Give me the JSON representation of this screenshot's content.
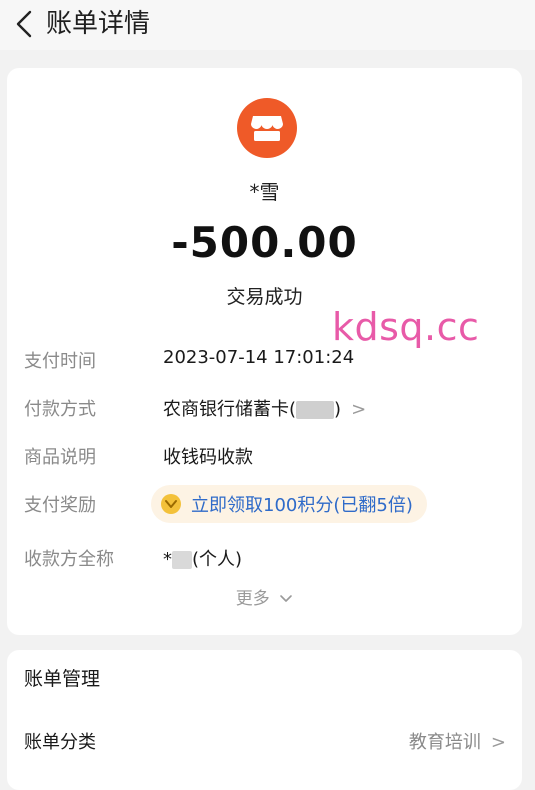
{
  "header": {
    "title": "账单详情",
    "back_icon": "chevron-left-icon"
  },
  "merchant": {
    "icon": "store-icon",
    "icon_bg": "#ef5a28",
    "name": "*雪"
  },
  "transaction": {
    "amount": "-500.00",
    "status": "交易成功"
  },
  "watermark": "kdsq.cc",
  "details": {
    "pay_time": {
      "label": "支付时间",
      "value": "2023-07-14 17:01:24"
    },
    "pay_method": {
      "label": "付款方式",
      "value_prefix": "农商银行储蓄卡(",
      "value_suffix": ")"
    },
    "product": {
      "label": "商品说明",
      "value": "收钱码收款"
    },
    "reward": {
      "label": "支付奖励",
      "value": "立即领取100积分(已翻5倍)"
    },
    "payee": {
      "label": "收款方全称",
      "value_prefix": "*",
      "value_suffix": "(个人)"
    }
  },
  "more": {
    "label": "更多",
    "icon": "chevron-down-icon"
  },
  "manage": {
    "title": "账单管理",
    "category_label": "账单分类",
    "category_value": "教育培训"
  },
  "colors": {
    "accent_blue": "#2f6bc9",
    "watermark_pink": "#e85aa8",
    "merchant_orange": "#ef5a28"
  }
}
